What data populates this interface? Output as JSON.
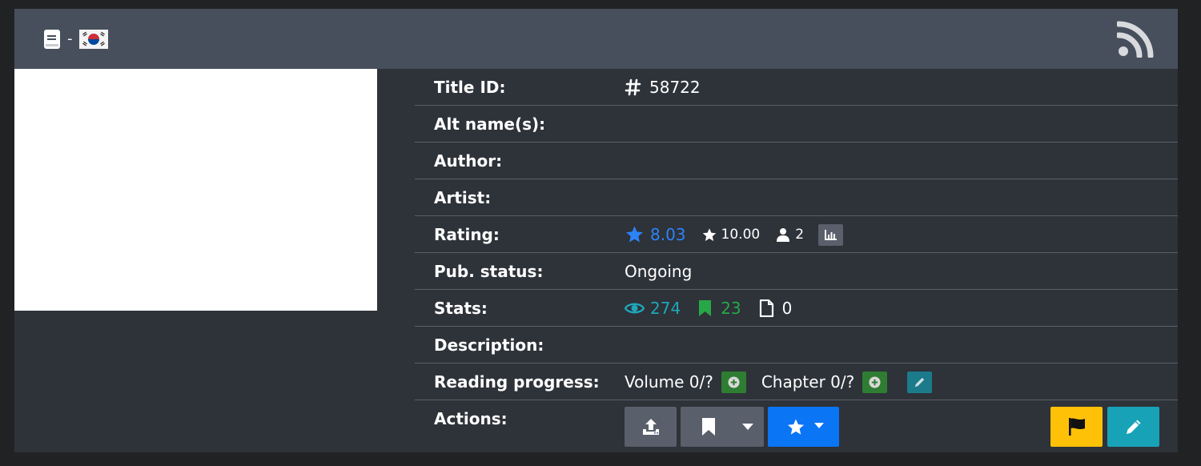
{
  "header": {
    "book_icon": "book-icon",
    "separator": "-",
    "flag_icon": "south-korea-flag-icon",
    "rss_icon": "rss-icon"
  },
  "details": {
    "title_id": {
      "label": "Title ID:",
      "value": "58722",
      "icon": "hash-icon"
    },
    "alt_names": {
      "label": "Alt name(s):"
    },
    "author": {
      "label": "Author:"
    },
    "artist": {
      "label": "Artist:"
    },
    "rating": {
      "label": "Rating:",
      "bayesian": "8.03",
      "mean": "10.00",
      "users": "2",
      "chart_icon": "bar-chart-icon"
    },
    "pub_status": {
      "label": "Pub. status:",
      "value": "Ongoing"
    },
    "stats": {
      "label": "Stats:",
      "views": "274",
      "follows": "23",
      "chapters": "0"
    },
    "description": {
      "label": "Description:"
    },
    "reading_progress": {
      "label": "Reading progress:",
      "volume": "Volume 0/?",
      "chapter": "Chapter 0/?"
    },
    "actions": {
      "label": "Actions:"
    }
  },
  "colors": {
    "header_bg": "#474f5c",
    "body_bg": "#2e3239",
    "accent_blue": "#2c83f7",
    "teal": "#1ea7b9",
    "green": "#27a847",
    "warning_yellow": "#ffc107",
    "info_cyan": "#17a2b8"
  }
}
